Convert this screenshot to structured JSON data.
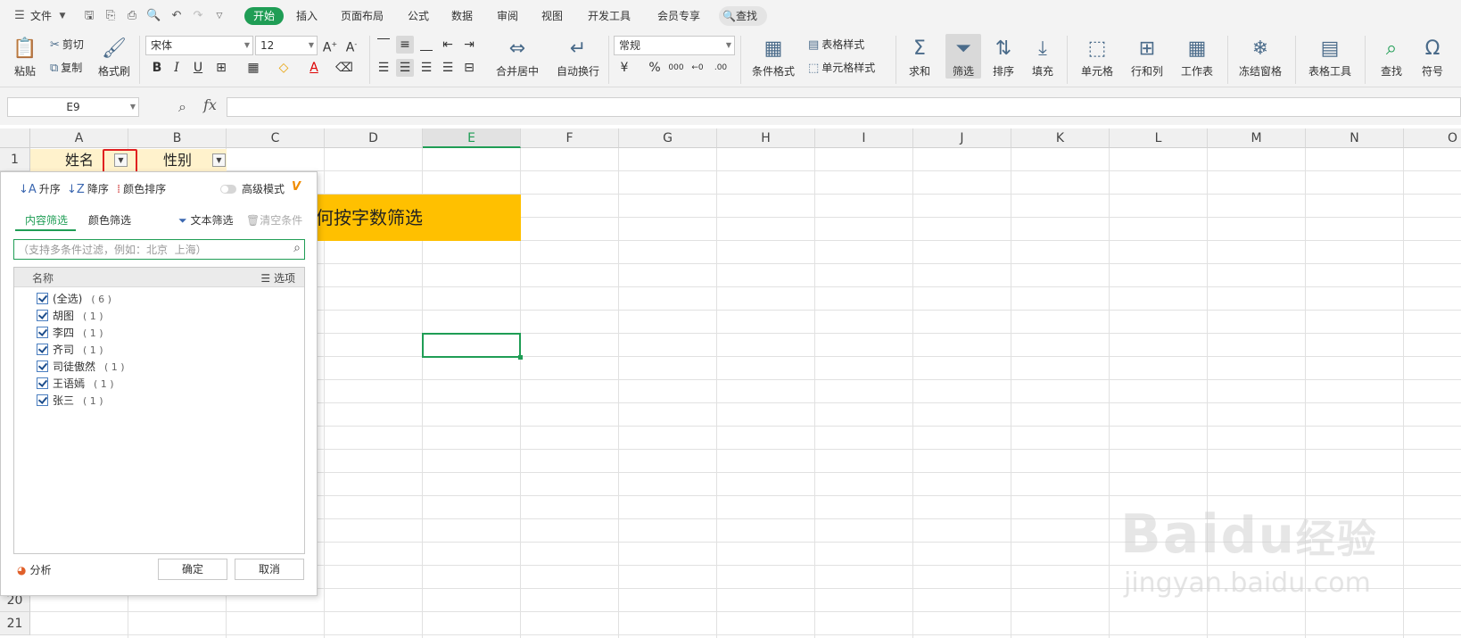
{
  "menubar": {
    "file": "文件",
    "tabs": [
      "开始",
      "插入",
      "页面布局",
      "公式",
      "数据",
      "审阅",
      "视图",
      "开发工具",
      "会员专享"
    ],
    "search": "查找"
  },
  "ribbon": {
    "paste": "粘贴",
    "cut": "剪切",
    "copy": "复制",
    "format_painter": "格式刷",
    "font_name": "宋体",
    "font_size": "12",
    "merge_center": "合并居中",
    "wrap_text": "自动换行",
    "number_format": "常规",
    "conditional_format": "条件格式",
    "table_style": "表格样式",
    "cell_style": "单元格样式",
    "sum": "求和",
    "filter": "筛选",
    "sort": "排序",
    "fill": "填充",
    "cell": "单元格",
    "row_col": "行和列",
    "worksheet": "工作表",
    "freeze": "冻结窗格",
    "table_tools": "表格工具",
    "find": "查找",
    "symbol": "符号"
  },
  "formula_bar": {
    "name_box": "E9",
    "fx": "fx",
    "formula": ""
  },
  "grid": {
    "columns": [
      "A",
      "B",
      "C",
      "D",
      "E",
      "F",
      "G",
      "H",
      "I",
      "J",
      "K",
      "L",
      "M",
      "N",
      "O"
    ],
    "selected_column": "E",
    "rows": [
      "1",
      "20",
      "21"
    ],
    "header_cells": [
      "姓名",
      "性别"
    ],
    "banner_text": "何按字数筛选"
  },
  "filter_panel": {
    "sort_asc": "升序",
    "sort_desc": "降序",
    "sort_color": "颜色排序",
    "advanced_mode": "高级模式",
    "vip": "V",
    "tab_content": "内容筛选",
    "tab_color": "颜色筛选",
    "text_filter": "文本筛选",
    "clear_conditions": "清空条件",
    "search_placeholder": "（支持多条件过滤，例如：北京  上海）",
    "list_header_name": "名称",
    "list_header_options": "选项",
    "items": [
      {
        "label": "(全选)",
        "count": "( 6 )"
      },
      {
        "label": "胡图",
        "count": "( 1 )"
      },
      {
        "label": "李四",
        "count": "( 1 )"
      },
      {
        "label": "齐司",
        "count": "( 1 )"
      },
      {
        "label": "司徒傲然",
        "count": "( 1 )"
      },
      {
        "label": "王语嫣",
        "count": "( 1 )"
      },
      {
        "label": "张三",
        "count": "( 1 )"
      }
    ],
    "analysis": "分析",
    "ok": "确定",
    "cancel": "取消"
  },
  "watermark": {
    "brand": "Bai经验",
    "url": "jingyan.baidu.com"
  },
  "colors": {
    "accent": "#1f9d55",
    "header_fill": "#fff2cc",
    "banner_fill": "#ffc000",
    "highlight_box": "#e02020"
  }
}
